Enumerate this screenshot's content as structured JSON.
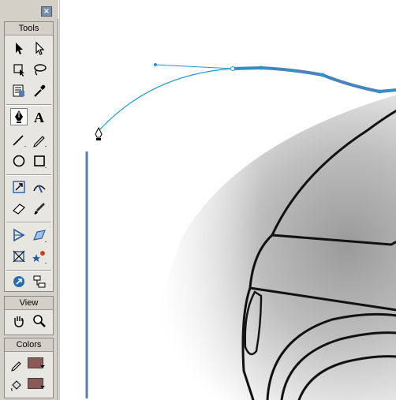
{
  "panel": {
    "close_glyph": "×",
    "tools_title": "Tools",
    "view_title": "View",
    "colors_title": "Colors"
  },
  "tools": [
    {
      "name": "arrow-tool",
      "icon": "arrow-icon"
    },
    {
      "name": "subselect-tool",
      "icon": "subselect-arrow-icon"
    },
    {
      "name": "free-transform-tool",
      "icon": "free-transform-icon"
    },
    {
      "name": "lasso-tool",
      "icon": "lasso-icon"
    },
    {
      "name": "text-edit-tool",
      "icon": "text-block-icon"
    },
    {
      "name": "eyedropper-tool",
      "icon": "eyedropper-icon"
    },
    {
      "name": "pen-tool",
      "icon": "pen-icon",
      "selected": true
    },
    {
      "name": "text-tool",
      "icon": "text-a-icon",
      "label": "A"
    },
    {
      "name": "line-tool",
      "icon": "line-icon"
    },
    {
      "name": "pencil-tool",
      "icon": "pencil-icon"
    },
    {
      "name": "oval-tool",
      "icon": "oval-icon"
    },
    {
      "name": "rectangle-tool",
      "icon": "rectangle-icon"
    },
    {
      "name": "scale-tool",
      "icon": "scale-icon"
    },
    {
      "name": "path-edit-tool",
      "icon": "path-edit-icon"
    },
    {
      "name": "eraser-tool",
      "icon": "eraser-icon"
    },
    {
      "name": "brush-tool",
      "icon": "brush-icon"
    },
    {
      "name": "gradient-tool",
      "icon": "gradient-icon"
    },
    {
      "name": "skew-tool",
      "icon": "skew-icon"
    },
    {
      "name": "crop-tool",
      "icon": "crop-icon"
    },
    {
      "name": "effects-tool",
      "icon": "effects-star-icon"
    },
    {
      "name": "link-tool",
      "icon": "link-icon"
    },
    {
      "name": "hierarchy-tool",
      "icon": "hierarchy-icon"
    }
  ],
  "view_tools": [
    {
      "name": "hand-tool",
      "icon": "hand-icon"
    },
    {
      "name": "zoom-tool",
      "icon": "magnifier-icon"
    }
  ],
  "colors": {
    "stroke_color": "#8a5a58",
    "fill_color": "#8a5a58"
  },
  "canvas": {
    "path_color": "#1a9ad6",
    "stroke_color": "#5a7bb0",
    "outline_color": "#111111"
  }
}
